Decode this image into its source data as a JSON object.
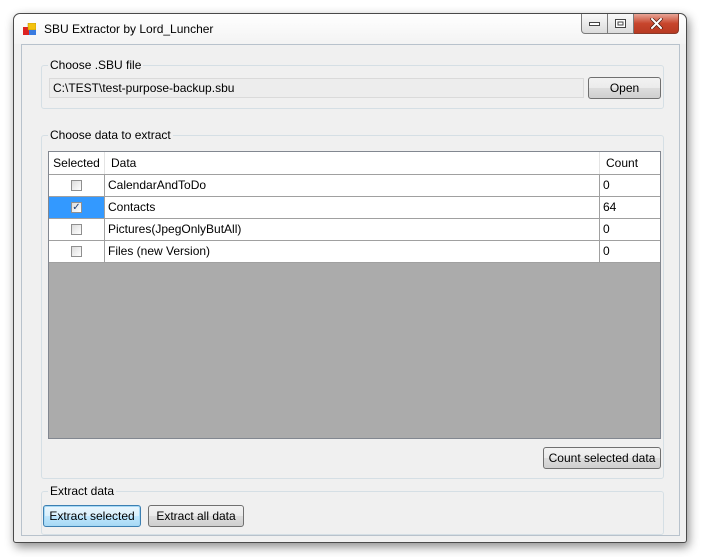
{
  "window": {
    "title": "SBU Extractor by Lord_Luncher",
    "icon": "app-icon",
    "controls": {
      "minimize": "minimize-icon",
      "maximize": "maximize-icon",
      "close": "close-icon"
    }
  },
  "file_group": {
    "label": "Choose .SBU file",
    "path": "C:\\TEST\\test-purpose-backup.sbu",
    "open_label": "Open"
  },
  "data_group": {
    "label": "Choose data to extract",
    "columns": [
      "Selected",
      "Data",
      "Count"
    ],
    "rows": [
      {
        "selected": false,
        "data": "CalendarAndToDo",
        "count": "0"
      },
      {
        "selected": true,
        "data": "Contacts",
        "count": "64"
      },
      {
        "selected": false,
        "data": "Pictures(JpegOnlyButAll)",
        "count": "0"
      },
      {
        "selected": false,
        "data": "Files (new Version)",
        "count": "0"
      }
    ],
    "count_button_label": "Count selected data"
  },
  "extract_group": {
    "label": "Extract data",
    "extract_selected_label": "Extract selected",
    "extract_all_label": "Extract all data"
  },
  "colors": {
    "selection": "#3399ff",
    "grid_background": "#ababab",
    "close_button": "#c7452c"
  }
}
